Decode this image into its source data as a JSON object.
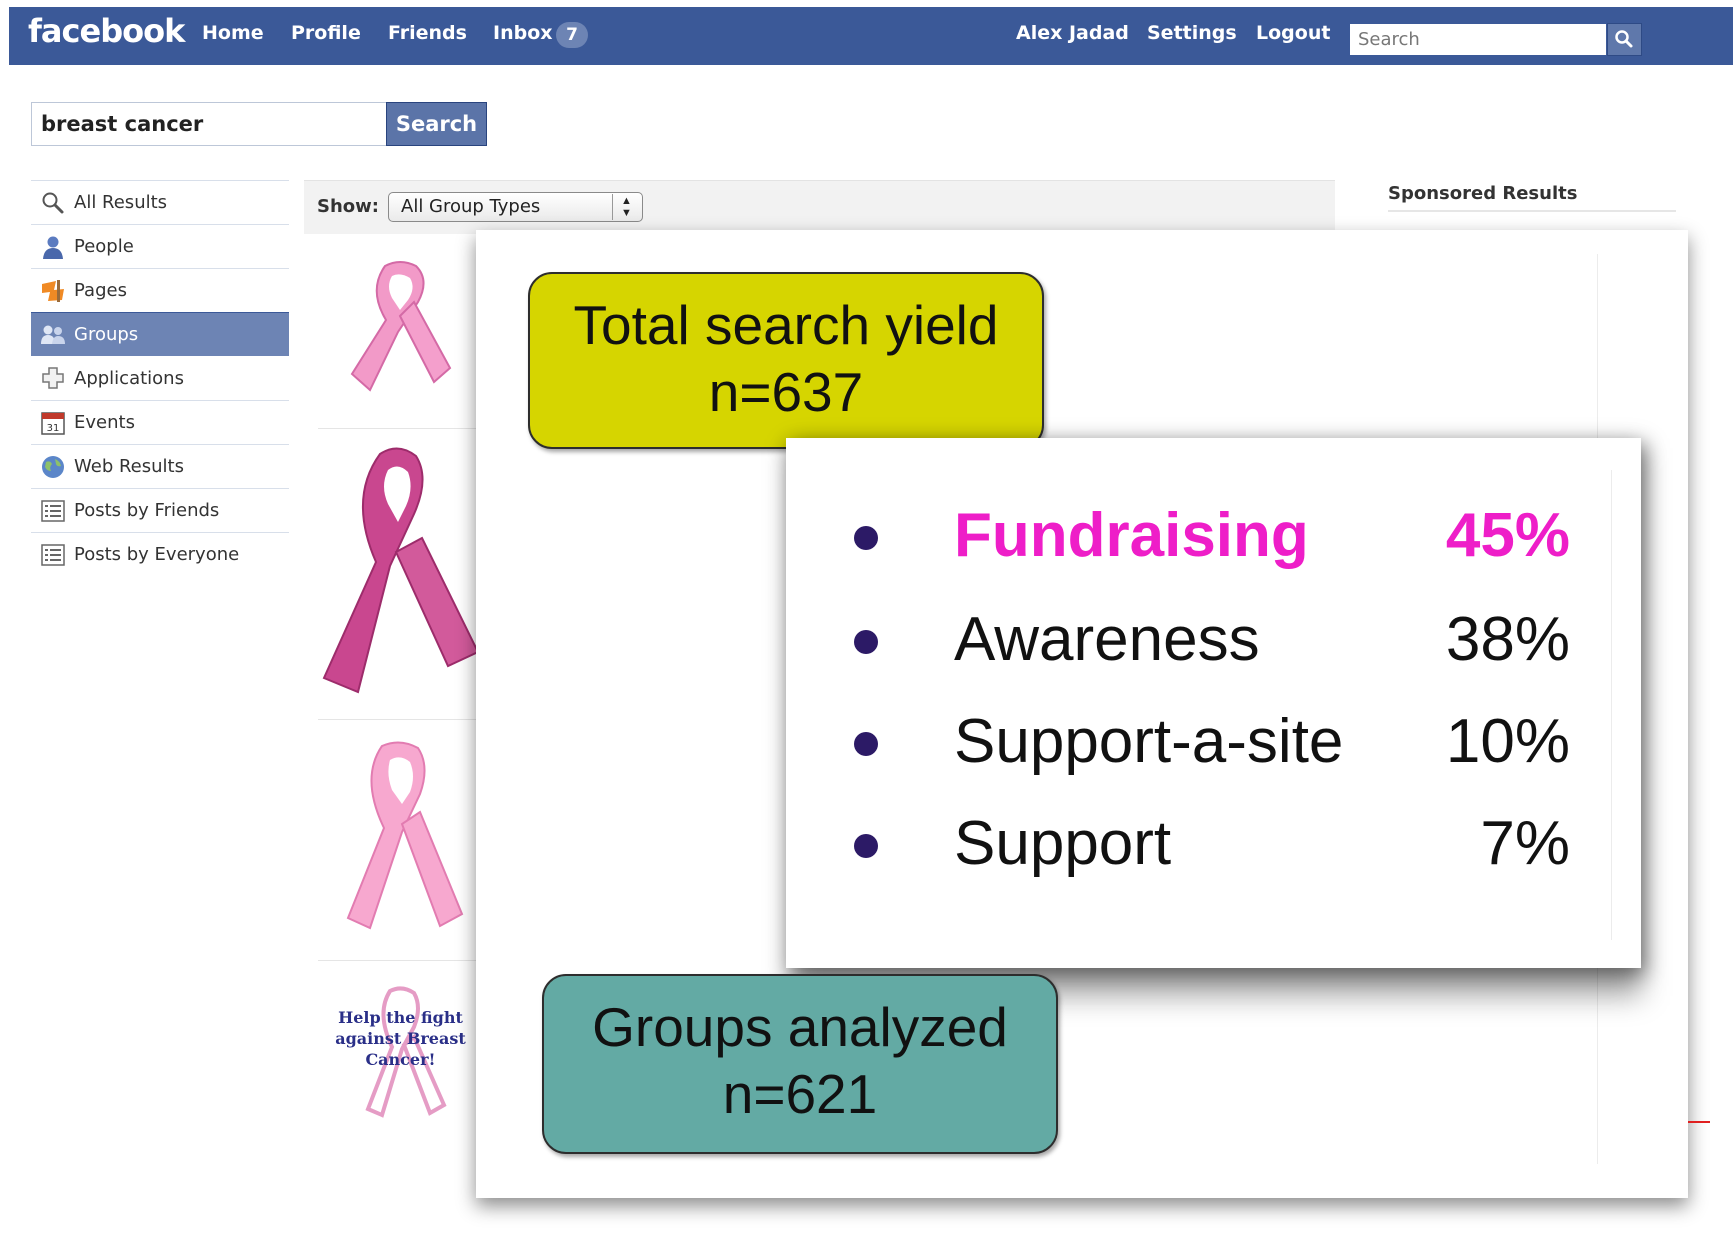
{
  "header": {
    "logo": "facebook",
    "nav": [
      "Home",
      "Profile",
      "Friends",
      "Inbox"
    ],
    "inbox_count": "7",
    "user_name": "Alex Jadad",
    "settings": "Settings",
    "logout": "Logout",
    "search_placeholder": "Search",
    "search_icon": "magnifier-icon"
  },
  "query": {
    "value": "breast cancer",
    "button": "Search"
  },
  "sidebar": {
    "items": [
      {
        "label": "All Results",
        "icon": "magnifier-icon"
      },
      {
        "label": "People",
        "icon": "person-icon"
      },
      {
        "label": "Pages",
        "icon": "flag-icon"
      },
      {
        "label": "Groups",
        "icon": "group-icon",
        "selected": true
      },
      {
        "label": "Applications",
        "icon": "puzzle-icon"
      },
      {
        "label": "Events",
        "icon": "calendar-icon"
      },
      {
        "label": "Web Results",
        "icon": "globe-icon"
      },
      {
        "label": "Posts by Friends",
        "icon": "list-icon"
      },
      {
        "label": "Posts by Everyone",
        "icon": "list-icon"
      }
    ],
    "events_day": "31"
  },
  "results": {
    "show_label": "Show:",
    "filter_value": "All Group Types",
    "ribbon_caption": "Help the fight against Breast Cancer!"
  },
  "sponsored": {
    "title": "Sponsored Results"
  },
  "overlay": {
    "total": {
      "line1": "Total search yield",
      "line2": "n=637"
    },
    "analyzed": {
      "line1": "Groups analyzed",
      "line2": "n=621"
    },
    "categories": [
      {
        "label": "Fundraising",
        "pct": "45%",
        "color": "#ee1ec8"
      },
      {
        "label": "Awareness",
        "pct": "38%",
        "color": "#111111"
      },
      {
        "label": "Support-a-site",
        "pct": "10%",
        "color": "#111111"
      },
      {
        "label": "Support",
        "pct": "7%",
        "color": "#111111"
      }
    ],
    "colors": {
      "total_box": "#d6d500",
      "analyzed_box": "#63aaa4",
      "bullet": "#2c1a66"
    }
  },
  "colors": {
    "brand": "#3b5998",
    "selected_nav": "#6d84b4"
  }
}
